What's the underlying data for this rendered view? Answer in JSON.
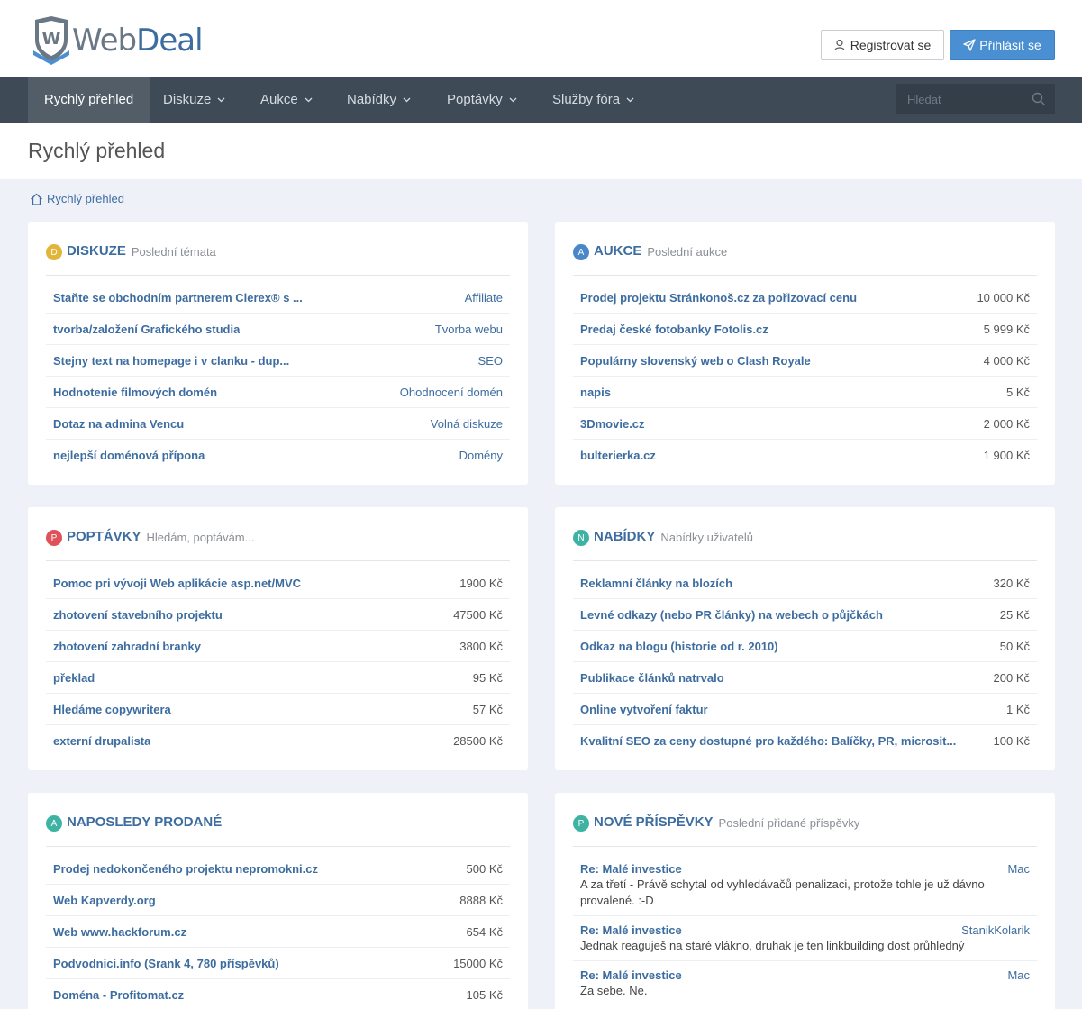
{
  "logo": {
    "part1": "Web",
    "part2": "Deal"
  },
  "header": {
    "register_label": "Registrovat se",
    "login_label": "Přihlásit se"
  },
  "nav": {
    "items": [
      "Rychlý přehled",
      "Diskuze",
      "Aukce",
      "Nabídky",
      "Poptávky",
      "Služby fóra"
    ],
    "search_placeholder": "Hledat"
  },
  "page": {
    "title": "Rychlý přehled",
    "breadcrumb": "Rychlý přehled"
  },
  "colors": {
    "yellow": "#e2b53a",
    "blue": "#4a87c8",
    "red": "#e0525a",
    "teal": "#3fb3a3"
  },
  "diskuze": {
    "badge": "D",
    "title": "DISKUZE",
    "subtitle": "Poslední témata",
    "rows": [
      {
        "title": "Staňte se obchodním partnerem Clerex® s ...",
        "value": "Affiliate"
      },
      {
        "title": "tvorba/založení Grafického studia",
        "value": "Tvorba webu"
      },
      {
        "title": "Stejny text na homepage i v clanku - dup...",
        "value": "SEO"
      },
      {
        "title": "Hodnotenie filmových domén",
        "value": "Ohodnocení domén"
      },
      {
        "title": "Dotaz na admina Vencu",
        "value": "Volná diskuze"
      },
      {
        "title": "nejlepší doménová přípona",
        "value": "Domény"
      }
    ]
  },
  "aukce": {
    "badge": "A",
    "title": "AUKCE",
    "subtitle": "Poslední aukce",
    "rows": [
      {
        "title": "Prodej projektu Stránkonoš.cz za pořizovací cenu",
        "value": "10 000 Kč"
      },
      {
        "title": "Predaj české fotobanky Fotolis.cz",
        "value": "5 999 Kč"
      },
      {
        "title": "Populárny slovenský web o Clash Royale",
        "value": "4 000 Kč"
      },
      {
        "title": "napis",
        "value": "5 Kč"
      },
      {
        "title": "3Dmovie.cz",
        "value": "2 000 Kč"
      },
      {
        "title": "bulterierka.cz",
        "value": "1 900 Kč"
      }
    ]
  },
  "poptavky": {
    "badge": "P",
    "title": "POPTÁVKY",
    "subtitle": "Hledám, poptávám...",
    "rows": [
      {
        "title": "Pomoc pri vývoji Web aplikácie asp.net/MVC",
        "value": "1900 Kč"
      },
      {
        "title": "zhotovení stavebního projektu",
        "value": "47500 Kč"
      },
      {
        "title": "zhotovení zahradní branky",
        "value": "3800 Kč"
      },
      {
        "title": "překlad",
        "value": "95 Kč"
      },
      {
        "title": "Hledáme copywritera",
        "value": "57 Kč"
      },
      {
        "title": "externí drupalista",
        "value": "28500 Kč"
      }
    ]
  },
  "nabidky": {
    "badge": "N",
    "title": "NABÍDKY",
    "subtitle": "Nabídky uživatelů",
    "rows": [
      {
        "title": "Reklamní články na blozích",
        "value": "320 Kč"
      },
      {
        "title": "Levné odkazy (nebo PR články) na webech o půjčkách",
        "value": "25 Kč"
      },
      {
        "title": "Odkaz na blogu (historie od r. 2010)",
        "value": "50 Kč"
      },
      {
        "title": "Publikace článků natrvalo",
        "value": "200 Kč"
      },
      {
        "title": "Online vytvoření faktur",
        "value": "1 Kč"
      },
      {
        "title": "Kvalitní SEO za ceny dostupné pro každého: Balíčky, PR, microsit...",
        "value": "100 Kč"
      }
    ]
  },
  "prodane": {
    "badge": "A",
    "title": "NAPOSLEDY PRODANÉ",
    "subtitle": "",
    "rows": [
      {
        "title": "Prodej nedokončeného projektu nepromokni.cz",
        "value": "500 Kč"
      },
      {
        "title": "Web Kapverdy.org",
        "value": "8888 Kč"
      },
      {
        "title": "Web www.hackforum.cz",
        "value": "654 Kč"
      },
      {
        "title": "Podvodnici.info (Srank 4, 780 příspěvků)",
        "value": "15000 Kč"
      },
      {
        "title": "Doména - Profitomat.cz",
        "value": "105 Kč"
      }
    ]
  },
  "prispevky": {
    "badge": "P",
    "title": "NOVÉ PŘÍSPĚVKY",
    "subtitle": "Poslední přidané příspěvky",
    "posts": [
      {
        "title": "Re: Malé investice",
        "user": "Mac",
        "text": "A za třetí - Právě schytal od vyhledávačů penalizaci, protože tohle je už dávno provalené. :-D"
      },
      {
        "title": "Re: Malé investice",
        "user": "StanikKolarik",
        "text": "Jednak reaguješ na staré vlákno, druhak je ten linkbuilding dost průhledný"
      },
      {
        "title": "Re: Malé investice",
        "user": "Mac",
        "text": "Za sebe. Ne."
      }
    ]
  }
}
